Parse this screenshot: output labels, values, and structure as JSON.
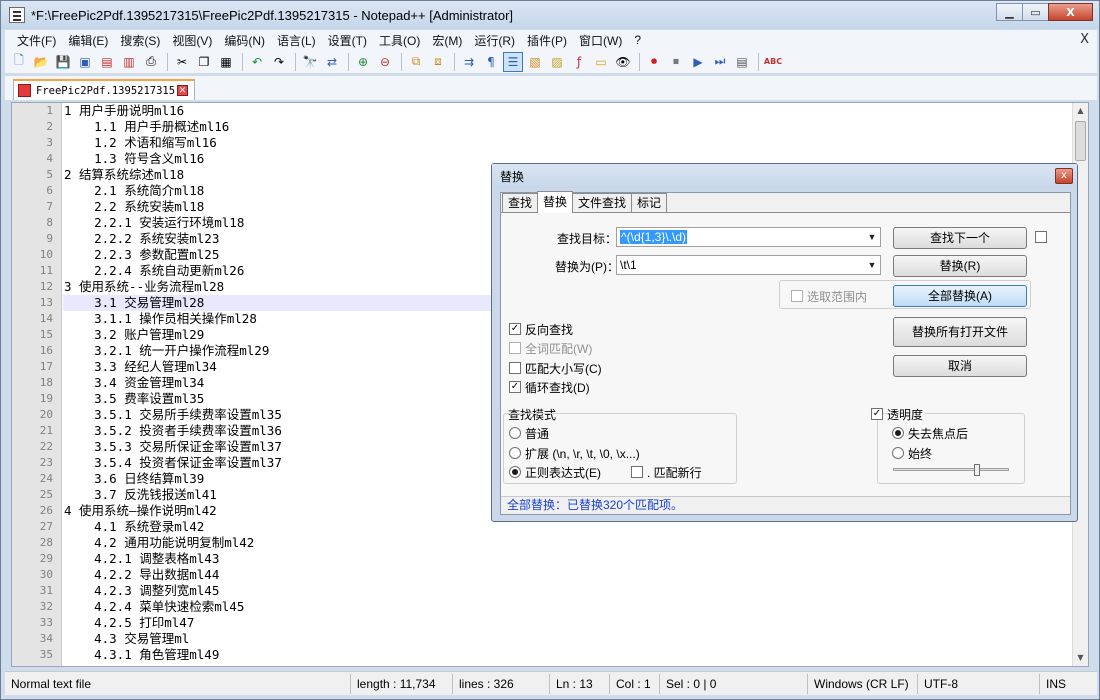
{
  "window": {
    "title": "*F:\\FreePic2Pdf.1395217315\\FreePic2Pdf.1395217315 - Notepad++ [Administrator]",
    "min_label": "0",
    "max_label": "□",
    "close_label": "X"
  },
  "menu": {
    "items": [
      "文件(F)",
      "编辑(E)",
      "搜索(S)",
      "视图(V)",
      "编码(N)",
      "语言(L)",
      "设置(T)",
      "工具(O)",
      "宏(M)",
      "运行(R)",
      "插件(P)",
      "窗口(W)",
      "?"
    ],
    "close_label": "X"
  },
  "tab": {
    "label": "FreePic2Pdf.1395217315"
  },
  "editor": {
    "current_line": 13,
    "lines": [
      "1 用户手册说明ml16",
      "    1.1 用户手册概述ml16",
      "    1.2 术语和缩写ml16",
      "    1.3 符号含义ml16",
      "2 结算系统综述ml18",
      "    2.1 系统简介ml18",
      "    2.2 系统安装ml18",
      "    2.2.1 安装运行环境ml18",
      "    2.2.2 系统安装ml23",
      "    2.2.3 参数配置ml25",
      "    2.2.4 系统自动更新ml26",
      "3 使用系统--业务流程ml28",
      "    3.1 交易管理ml28",
      "    3.1.1 操作员相关操作ml28",
      "    3.2 账户管理ml29",
      "    3.2.1 统一开户操作流程ml29",
      "    3.3 经纪人管理ml34",
      "    3.4 资金管理ml34",
      "    3.5 费率设置ml35",
      "    3.5.1 交易所手续费率设置ml35",
      "    3.5.2 投资者手续费率设置ml36",
      "    3.5.3 交易所保证金率设置ml37",
      "    3.5.4 投资者保证金率设置ml37",
      "    3.6 日终结算ml39",
      "    3.7 反洗钱报送ml41",
      "4 使用系统—操作说明ml42",
      "    4.1 系统登录ml42",
      "    4.2 通用功能说明复制ml42",
      "    4.2.1 调整表格ml43",
      "    4.2.2 导出数据ml44",
      "    4.2.3 调整列宽ml45",
      "    4.2.4 菜单快速检索ml45",
      "    4.2.5 打印ml47",
      "    4.3 交易管理ml",
      "    4.3.1 角色管理ml49"
    ]
  },
  "statusbar": {
    "file_type": "Normal text file",
    "length": "length : 11,734",
    "lines": "lines : 326",
    "ln": "Ln : 13",
    "col": "Col : 1",
    "sel": "Sel : 0 | 0",
    "eol": "Windows (CR LF)",
    "encoding": "UTF-8",
    "mode": "INS"
  },
  "dialog": {
    "title": "替换",
    "close_label": "x",
    "tabs": [
      "查找",
      "替换",
      "文件查找",
      "标记"
    ],
    "find_label": "查找目标：",
    "find_value": "^(\\d{1,3}\\.\\d)",
    "replace_label": "替换为(P)：",
    "replace_value": "\\t\\1",
    "in_selection_label": "选取范围内",
    "buttons": {
      "find_next": "查找下一个",
      "replace": "替换(R)",
      "replace_all": "全部替换(A)",
      "replace_all_open": "替换所有打开文件",
      "cancel": "取消"
    },
    "options": {
      "backward": "反向查找",
      "whole_word": "全词匹配(W)",
      "match_case": "匹配大小写(C)",
      "wrap": "循环查找(D)"
    },
    "search_mode": {
      "title": "查找模式",
      "normal": "普通",
      "extended": "扩展 (\\n, \\r, \\t, \\0, \\x...)",
      "regex": "正则表达式(E)",
      "dot_newline": ". 匹配新行"
    },
    "transparency": {
      "title": "透明度",
      "on_lose_focus": "失去焦点后",
      "always": "始终"
    },
    "status": "全部替换：已替换320个匹配项。"
  }
}
